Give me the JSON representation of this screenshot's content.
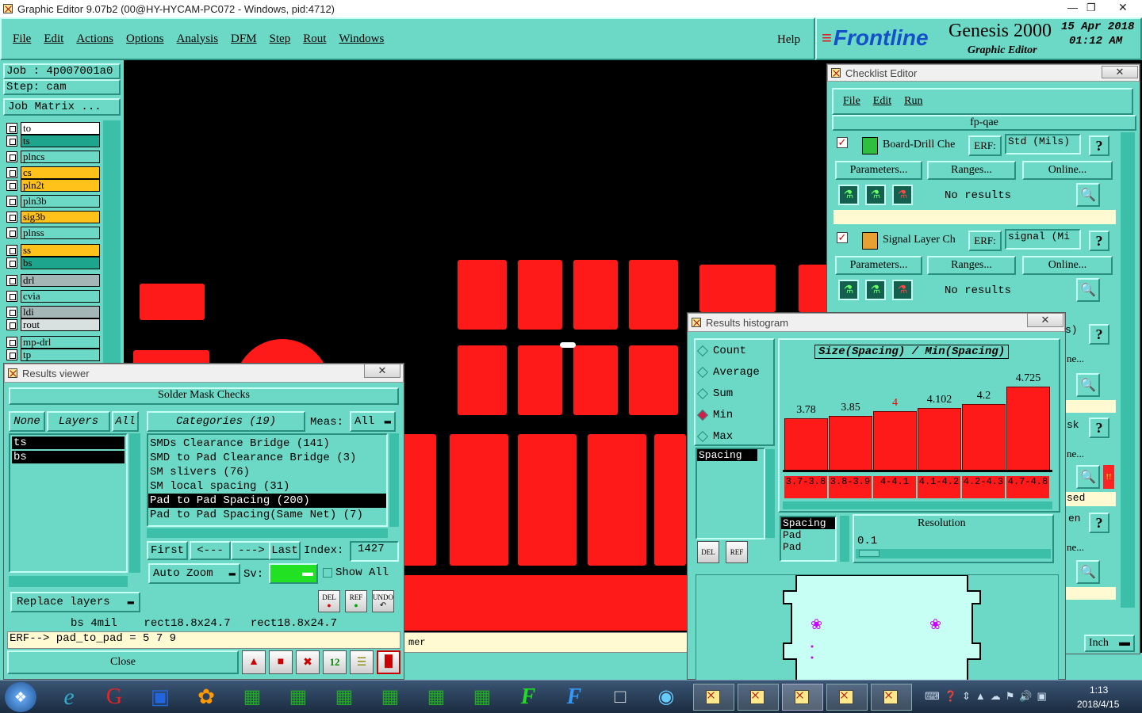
{
  "app": {
    "title": "Graphic Editor 9.07b2 (00@HY-HYCAM-PC072 - Windows, pid:4712)"
  },
  "menu": {
    "items": [
      "File",
      "Edit",
      "Actions",
      "Options",
      "Analysis",
      "DFM",
      "Step",
      "Rout",
      "Windows"
    ],
    "help": "Help"
  },
  "brand": {
    "logo": "Frontline",
    "product": "Genesis 2000",
    "subtitle": "Graphic Editor",
    "date": "15 Apr 2018",
    "time": "01:12 AM"
  },
  "job": {
    "job": "Job : 4p007001a0",
    "step": "Step: cam",
    "matrix": "Job Matrix ..."
  },
  "layers": [
    "to",
    "ts",
    "plncs",
    "cs",
    "pln2t",
    "pln3b",
    "sig3b",
    "plnss",
    "ss",
    "bs",
    "drl",
    "cvia",
    "ldi",
    "rout",
    "mp-drl",
    "tp"
  ],
  "results_viewer": {
    "title": "Results viewer",
    "heading": "Solder Mask Checks",
    "none": "None",
    "layers_btn": "Layers",
    "all": "All",
    "categories": "Categories (19)",
    "meas_label": "Meas:",
    "meas_value": "All",
    "layer_list": [
      "ts",
      "bs"
    ],
    "category_list": [
      "SMDs Clearance Bridge (141)",
      "SMD to Pad Clearance Bridge (3)",
      "SM slivers (76)",
      "SM local spacing (31)",
      "Pad to Pad Spacing (200)",
      "Pad to Pad Spacing(Same Net) (7)"
    ],
    "first": "First",
    "prev": "<---",
    "next": "--->",
    "last": "Last",
    "index_label": "Index:",
    "index_value": "1427",
    "auto_zoom": "Auto Zoom",
    "sv": "Sv:",
    "show_all": "Show All",
    "replace_layers": "Replace layers",
    "del": "DEL",
    "ref": "REF",
    "undo": "UNDO",
    "status": "bs 4mil    rect18.8x24.7   rect18.8x24.7",
    "erf": "ERF--> pad_to_pad = 5 7 9",
    "close": "Close"
  },
  "checklist": {
    "title": "Checklist Editor",
    "menu": [
      "File",
      "Edit",
      "Run"
    ],
    "name": "fp-qae",
    "checks": [
      {
        "name": "Board-Drill Che",
        "erf": "ERF:",
        "erf_value": "Std (Mils)",
        "status": "No results"
      },
      {
        "name": "Signal Layer Ch",
        "erf": "ERF:",
        "erf_value": "signal (Mi",
        "status": "No results"
      }
    ],
    "parameters": "Parameters...",
    "ranges": "Ranges...",
    "online": "Online...",
    "partial": [
      "s)",
      "ne...",
      "sk",
      "ne...",
      "sed",
      "en",
      "ne..."
    ]
  },
  "histogram": {
    "title": "Results histogram",
    "options": [
      "Count",
      "Average",
      "Sum",
      "Min",
      "Max"
    ],
    "selected": "Min",
    "list_item": "Spacing",
    "chart_title": "Size(Spacing) / Min(Spacing)",
    "del": "DEL",
    "ref": "REF",
    "pad_list": [
      "Spacing",
      "Pad",
      "Pad"
    ],
    "resolution_label": "Resolution",
    "resolution_value": "0.1"
  },
  "chart_data": {
    "type": "bar",
    "title": "Size(Spacing) / Min(Spacing)",
    "categories": [
      "3.7-3.8",
      "3.8-3.9",
      "4-4.1",
      "4.1-4.2",
      "4.2-4.3",
      "4.7-4.8"
    ],
    "values": [
      3.78,
      3.85,
      4,
      4.102,
      4.2,
      4.725
    ],
    "labels": [
      "3.78",
      "3.85",
      "4",
      "4.102",
      "4.2",
      "4.725"
    ],
    "ylim": [
      0,
      4.8
    ],
    "highlight_color": "#ff1a1a",
    "bar_color": "#ff1a1a"
  },
  "units": {
    "inch": "Inch"
  },
  "status_fragment": "mer",
  "taskbar": {
    "time": "1:13",
    "date": "2018/4/15"
  },
  "colors": {
    "teal": "#6cd9c6",
    "red": "#ff1a1a",
    "cream": "#fffad2"
  }
}
